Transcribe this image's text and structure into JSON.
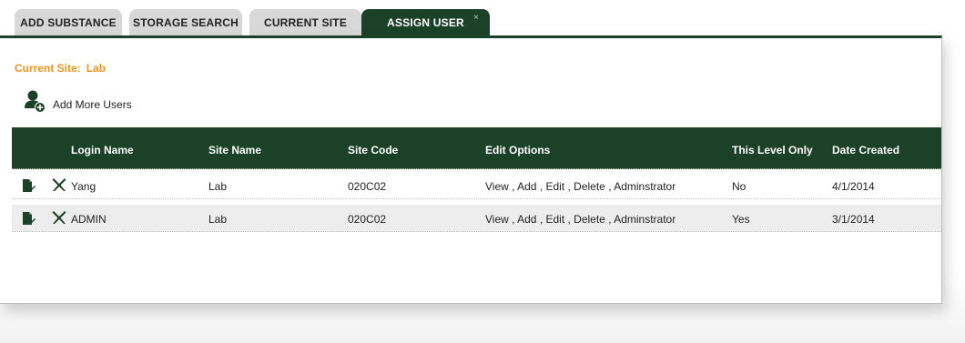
{
  "tabs": [
    {
      "label": "ADD SUBSTANCE"
    },
    {
      "label": "STORAGE SEARCH"
    },
    {
      "label": "CURRENT SITE"
    },
    {
      "label": "ASSIGN USER",
      "close": "×"
    }
  ],
  "current_site": {
    "label": "Current Site:",
    "value": "Lab"
  },
  "add_users": {
    "label": "Add More Users"
  },
  "table": {
    "columns": [
      "Login Name",
      "Site Name",
      "Site Code",
      "Edit Options",
      "This Level Only",
      "Date Created"
    ],
    "rows": [
      {
        "login": "Yang",
        "site": "Lab",
        "code": "020C02",
        "options": "View , Add , Edit , Delete , Adminstrator",
        "level": "No",
        "date": "4/1/2014"
      },
      {
        "login": "ADMIN",
        "site": "Lab",
        "code": "020C02",
        "options": "View , Add , Edit , Delete , Adminstrator",
        "level": "Yes",
        "date": "3/1/2014"
      }
    ]
  },
  "colors": {
    "brand": "#1b4228",
    "accent": "#e8951c"
  },
  "icons": {
    "edit": "edit-icon",
    "delete": "delete-icon",
    "add_user": "add-user-icon"
  }
}
